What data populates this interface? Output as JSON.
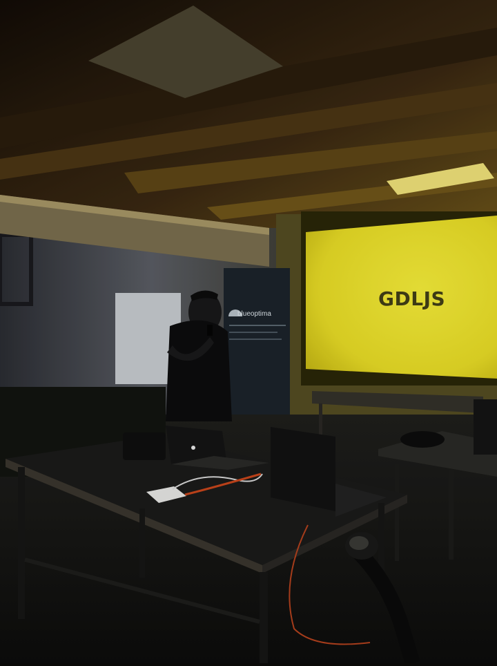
{
  "slide": {
    "title": "GDLJS"
  },
  "banner": {
    "logo_text": "blueoptima"
  },
  "colors": {
    "screen": "#f2e62a",
    "screen_edge": "#b9ad10",
    "ceiling_wood": "#3a2a12",
    "wall": "#46484e",
    "floor": "#151515"
  }
}
